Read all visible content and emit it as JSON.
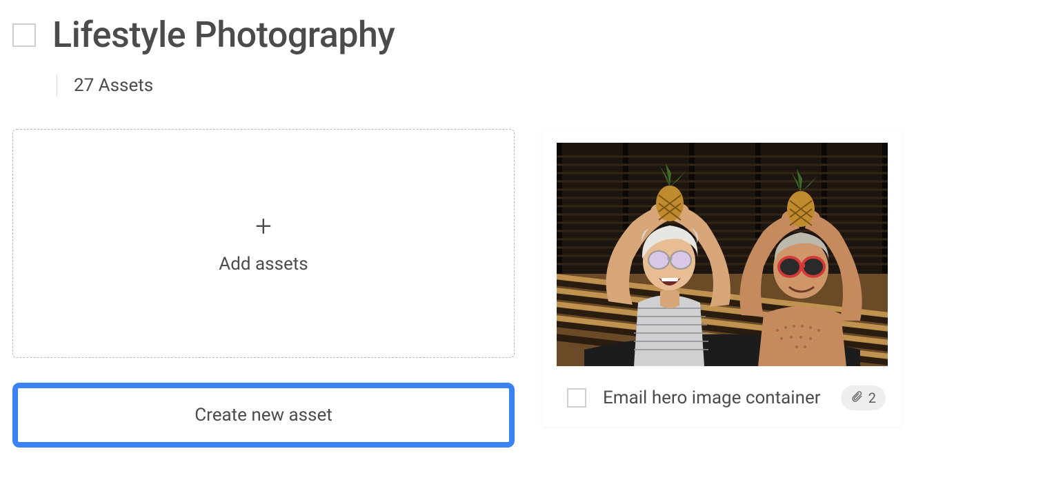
{
  "header": {
    "title": "Lifestyle Photography",
    "asset_count_label": "27 Assets"
  },
  "dropzone": {
    "label": "Add assets",
    "plus_glyph": "+"
  },
  "create_button": {
    "label": "Create new asset"
  },
  "card": {
    "title": "Email hero image container",
    "attachment_count": "2"
  }
}
